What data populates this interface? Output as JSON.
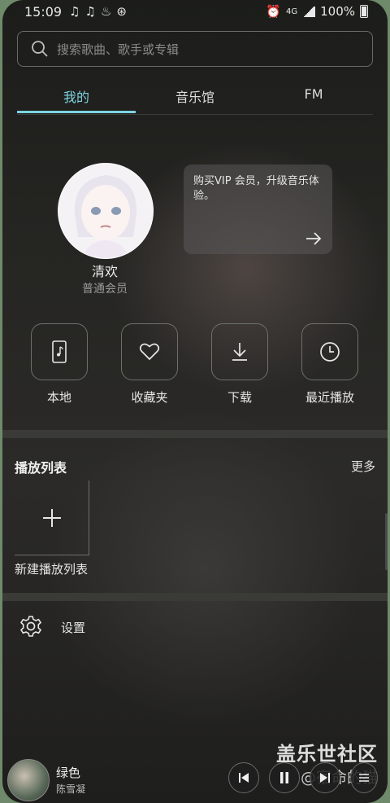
{
  "status_bar": {
    "time": "15:09",
    "notification_icons": [
      "music-note-icon",
      "music-note-icon",
      "app-icon",
      "app-icon"
    ],
    "network": "4G",
    "battery": "100%"
  },
  "search": {
    "placeholder": "搜索歌曲、歌手或专辑"
  },
  "tabs": [
    {
      "label": "我的",
      "active": true
    },
    {
      "label": "音乐馆",
      "active": false
    },
    {
      "label": "FM",
      "active": false
    }
  ],
  "profile": {
    "name": "清欢",
    "membership": "普通会员"
  },
  "vip_card": {
    "text": "购买VIP 会员，升级音乐体验。"
  },
  "quick_actions": [
    {
      "label": "本地",
      "icon": "phone-music-icon"
    },
    {
      "label": "收藏夹",
      "icon": "heart-icon"
    },
    {
      "label": "下载",
      "icon": "download-icon"
    },
    {
      "label": "最近播放",
      "icon": "clock-icon"
    }
  ],
  "playlists": {
    "title": "播放列表",
    "more": "更多",
    "new_playlist": "新建播放列表"
  },
  "settings": {
    "label": "设置"
  },
  "player": {
    "song": "绿色",
    "artist": "陈雪凝"
  },
  "watermark": {
    "line1": "盖乐世社区",
    "line2": "@宿命的猫"
  },
  "colors": {
    "accent": "#7cd3e1"
  }
}
